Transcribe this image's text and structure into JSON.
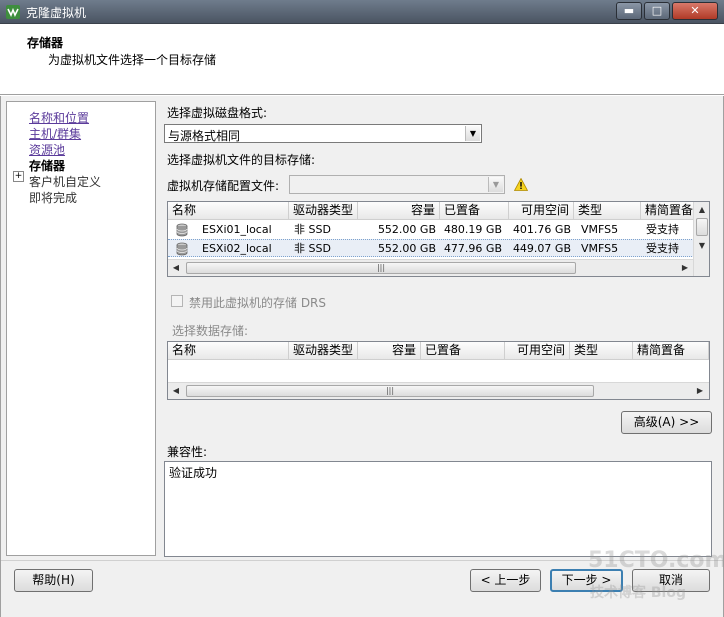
{
  "window": {
    "title": "克隆虚拟机",
    "controls": {
      "minimize": "▬",
      "maximize": "□",
      "close": "✕"
    }
  },
  "header": {
    "title": "存储器",
    "subtitle": "为虚拟机文件选择一个目标存储"
  },
  "nav": {
    "items": [
      {
        "label": "名称和位置",
        "state": "link"
      },
      {
        "label": "主机/群集",
        "state": "link"
      },
      {
        "label": "资源池",
        "state": "link"
      },
      {
        "label": "存储器",
        "state": "active"
      },
      {
        "label": "客户机自定义",
        "state": "disabled"
      },
      {
        "label": "即将完成",
        "state": "disabled"
      }
    ]
  },
  "disk_format": {
    "label": "选择虚拟磁盘格式:",
    "value": "与源格式相同"
  },
  "target_storage_label": "选择虚拟机文件的目标存储:",
  "vm_storage_profile": {
    "label": "虚拟机存储配置文件:",
    "value": ""
  },
  "datastores": {
    "columns": [
      "名称",
      "驱动器类型",
      "容量",
      "已置备",
      "可用空间",
      "类型",
      "精简置备"
    ],
    "rows": [
      [
        "ESXi01_local",
        "非 SSD",
        "552.00 GB",
        "480.19 GB",
        "401.76 GB",
        "VMFS5",
        "受支持"
      ],
      [
        "ESXi02_local",
        "非 SSD",
        "552.00 GB",
        "477.96 GB",
        "449.07 GB",
        "VMFS5",
        "受支持"
      ]
    ],
    "selected_row": 1
  },
  "disable_drs": {
    "label": "禁用此虚拟机的存储 DRS",
    "checked": false
  },
  "select_datastore": {
    "label": "选择数据存储:",
    "columns": [
      "名称",
      "驱动器类型",
      "容量",
      "已置备",
      "可用空间",
      "类型",
      "精简置备"
    ]
  },
  "advanced_button": "高级(A) >>",
  "compatibility": {
    "label": "兼容性:",
    "value": "验证成功"
  },
  "footer": {
    "help": "帮助(H)",
    "back": "< 上一步",
    "next": "下一步 >",
    "cancel": "取消"
  },
  "watermark": {
    "line1": "51CTO.com",
    "line2": "技术博客 Blog"
  },
  "colors": {
    "link": "#5b3b9b",
    "selection": "#e9eef6",
    "titlebar": "#4a5462"
  }
}
